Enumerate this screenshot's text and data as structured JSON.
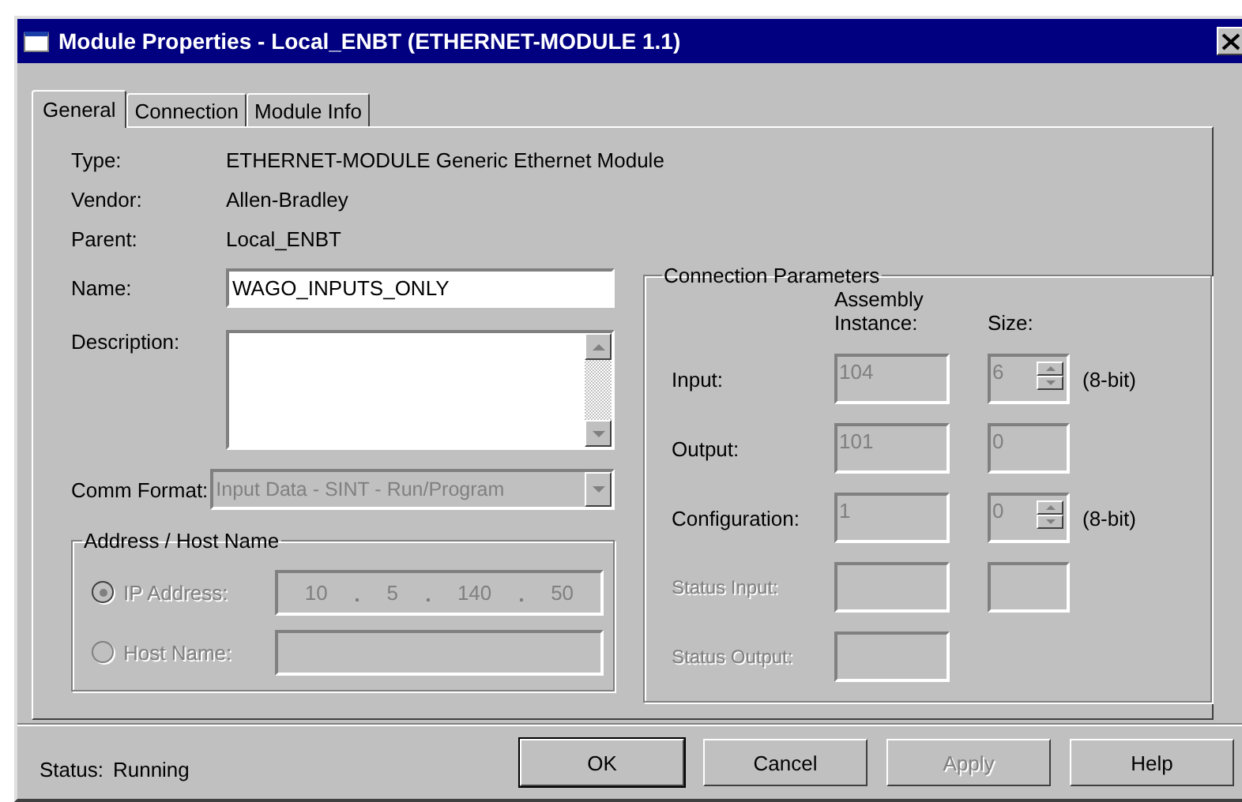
{
  "window": {
    "title": "Module Properties - Local_ENBT (ETHERNET-MODULE 1.1)"
  },
  "tabs": [
    {
      "label": "General",
      "selected": true
    },
    {
      "label": "Connection",
      "selected": false
    },
    {
      "label": "Module Info",
      "selected": false
    }
  ],
  "info_rows": [
    {
      "label": "Type:",
      "value": "ETHERNET-MODULE Generic Ethernet Module"
    },
    {
      "label": "Vendor:",
      "value": "Allen-Bradley"
    },
    {
      "label": "Parent:",
      "value": "Local_ENBT"
    }
  ],
  "name_field": {
    "label": "Name:",
    "value": "WAGO_INPUTS_ONLY"
  },
  "description_field": {
    "label": "Description:"
  },
  "comm_format": {
    "label": "Comm Format:",
    "value": "Input Data - SINT - Run/Program",
    "disabled": true
  },
  "address_group": {
    "title": "Address / Host Name",
    "options": [
      {
        "kind": "ip",
        "label": "IP Address:",
        "selected": true,
        "disabled": true,
        "octets": [
          "10",
          "5",
          "140",
          "50"
        ]
      },
      {
        "kind": "host",
        "label": "Host Name:",
        "selected": false,
        "disabled": true
      }
    ]
  },
  "connection_parameters": {
    "title": "Connection Parameters",
    "column_headers": [
      "Assembly Instance:",
      "Size:"
    ],
    "rows": [
      {
        "label": "Input:",
        "disabled": false,
        "instance": "104",
        "size": "6",
        "size_box": true,
        "spinner": true,
        "unit": "(8-bit)"
      },
      {
        "label": "Output:",
        "disabled": false,
        "instance": "101",
        "size": "0",
        "size_box": true,
        "spinner": false
      },
      {
        "label": "Configuration:",
        "disabled": false,
        "instance": "1",
        "size": "0",
        "size_box": true,
        "spinner": true,
        "unit": "(8-bit)"
      },
      {
        "label": "Status Input:",
        "disabled": true,
        "size_box": true,
        "spinner": false
      },
      {
        "label": "Status Output:",
        "disabled": true,
        "size_box": false
      }
    ]
  },
  "status": {
    "label": "Status:",
    "value": "Running"
  },
  "buttons": [
    {
      "label": "OK",
      "default": true,
      "disabled": false
    },
    {
      "label": "Cancel",
      "default": false,
      "disabled": false
    },
    {
      "label": "Apply",
      "default": false,
      "disabled": true
    },
    {
      "label": "Help",
      "default": false,
      "disabled": false
    }
  ]
}
